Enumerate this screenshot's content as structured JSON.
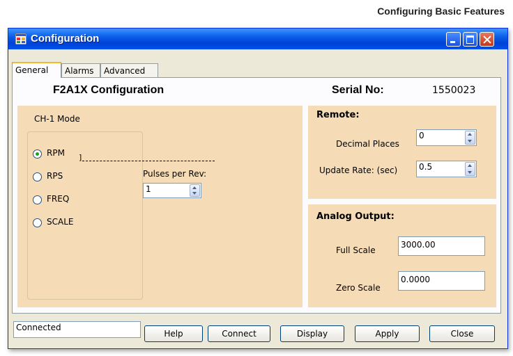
{
  "document": {
    "header": "Configuring Basic Features"
  },
  "window": {
    "title": "Configuration",
    "colors": {
      "panel": "#f5dcb7",
      "titlebar": "#0a5ee8",
      "close": "#c4361a"
    }
  },
  "tabs": [
    {
      "label": "General",
      "active": true
    },
    {
      "label": "Alarms"
    },
    {
      "label": "Advanced"
    }
  ],
  "general": {
    "heading": "F2A1X Configuration",
    "serial_label": "Serial No:",
    "serial_value": "1550023",
    "mode": {
      "label": "CH-1 Mode",
      "options": [
        "RPM",
        "RPS",
        "FREQ",
        "SCALE"
      ],
      "selected": "RPM",
      "pulses_label": "Pulses per Rev:",
      "pulses_value": "1"
    },
    "remote": {
      "title": "Remote:",
      "decimal_label": "Decimal Places",
      "decimal_value": "0",
      "update_label": "Update Rate: (sec)",
      "update_value": "0.5"
    },
    "analog": {
      "title": "Analog Output:",
      "full_label": "Full Scale",
      "full_value": "3000.00",
      "zero_label": "Zero Scale",
      "zero_value": "0.0000"
    }
  },
  "status": "Connected",
  "buttons": {
    "help": "Help",
    "connect": "Connect",
    "display": "Display",
    "apply": "Apply",
    "close": "Close"
  }
}
